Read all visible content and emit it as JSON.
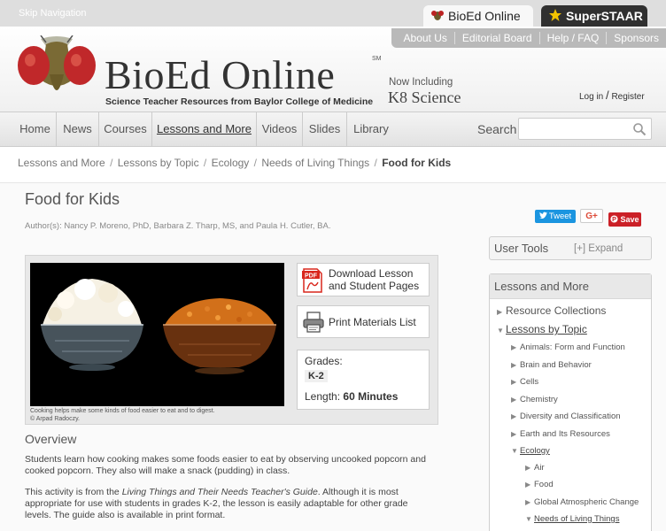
{
  "top": {
    "skip_nav": "Skip Navigation",
    "tab_bioed": "BioEd Online",
    "tab_staar": "SuperSTAAR"
  },
  "header": {
    "util_links": [
      "About Us",
      "Editorial Board",
      "Help / FAQ",
      "Sponsors"
    ],
    "logo_title": "BioEd Online",
    "logo_sm": "SM",
    "tagline": "Science Teacher Resources from Baylor College of Medicine",
    "now_including": "Now Including",
    "k8": "K8 Science",
    "login": "Log in",
    "login_sep": "/",
    "register": "Register"
  },
  "nav": {
    "items": [
      "Home",
      "News",
      "Courses",
      "Lessons and More",
      "Videos",
      "Slides",
      "Library"
    ],
    "active": "Lessons and More",
    "search_label": "Search"
  },
  "breadcrumb": [
    "Lessons and More",
    "Lessons by Topic",
    "Ecology",
    "Needs of Living Things",
    "Food for Kids"
  ],
  "page": {
    "title": "Food for Kids",
    "authors": "Author(s): Nancy P. Moreno, PhD, Barbara Z. Tharp, MS, and Paula H. Cutler, BA.",
    "caption_1": "Cooking helps make some kinds of food easier to eat and to digest.",
    "caption_2": "© Arpad Radoczy.",
    "download_btn": "Download Lesson and Student Pages",
    "print_btn": "Print Materials List",
    "grades_label": "Grades:",
    "grades_value": "K-2",
    "length_label": "Length:",
    "length_value": "60 Minutes",
    "overview_heading": "Overview",
    "overview_p1": "Students learn how cooking makes some foods easier to eat by observing uncooked popcorn and cooked popcorn. They also will make a snack (pudding) in class.",
    "overview_p2_a": "This activity is from the ",
    "overview_p2_em": "Living Things and Their Needs Teacher's Guide",
    "overview_p2_b": ". Although it is most appropriate for use with students in grades K-2, the lesson is easily adaptable for other grade levels. The guide also is available in print format."
  },
  "social": {
    "tweet": "Tweet",
    "gplus": "G+",
    "save": "Save"
  },
  "sidebar": {
    "user_tools": "User Tools",
    "expand": "[+] Expand",
    "lam_heading": "Lessons and More",
    "items": [
      {
        "label": "Resource Collections",
        "level": 1,
        "open": false
      },
      {
        "label": "Lessons by Topic",
        "level": 1,
        "open": true,
        "selected": true
      },
      {
        "label": "Animals: Form and Function",
        "level": 2,
        "open": false
      },
      {
        "label": "Brain and Behavior",
        "level": 2,
        "open": false
      },
      {
        "label": "Cells",
        "level": 2,
        "open": false
      },
      {
        "label": "Chemistry",
        "level": 2,
        "open": false
      },
      {
        "label": "Diversity and Classification",
        "level": 2,
        "open": false
      },
      {
        "label": "Earth and Its Resources",
        "level": 2,
        "open": false
      },
      {
        "label": "Ecology",
        "level": 2,
        "open": true,
        "selected": true
      },
      {
        "label": "Air",
        "level": 3,
        "open": false
      },
      {
        "label": "Food",
        "level": 3,
        "open": false
      },
      {
        "label": "Global Atmospheric Change",
        "level": 3,
        "open": false
      },
      {
        "label": "Needs of Living Things",
        "level": 3,
        "open": true,
        "selected": true
      }
    ]
  },
  "colors": {
    "staar_tab": "#303030",
    "tweet": "#1b95e0",
    "pin": "#cb2027",
    "pdf": "#d9261c"
  }
}
